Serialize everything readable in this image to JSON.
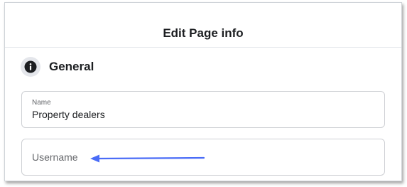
{
  "dialog": {
    "title": "Edit Page info"
  },
  "section": {
    "title": "General",
    "icon": "info-icon"
  },
  "fields": {
    "name": {
      "label": "Name",
      "value": "Property dealers"
    },
    "username": {
      "placeholder": "Username",
      "value": ""
    }
  },
  "annotation": {
    "arrow_color": "#4a6cf7"
  },
  "colors": {
    "text_primary": "#1c1e21",
    "text_secondary": "#65676b",
    "border": "#ced0d4"
  }
}
